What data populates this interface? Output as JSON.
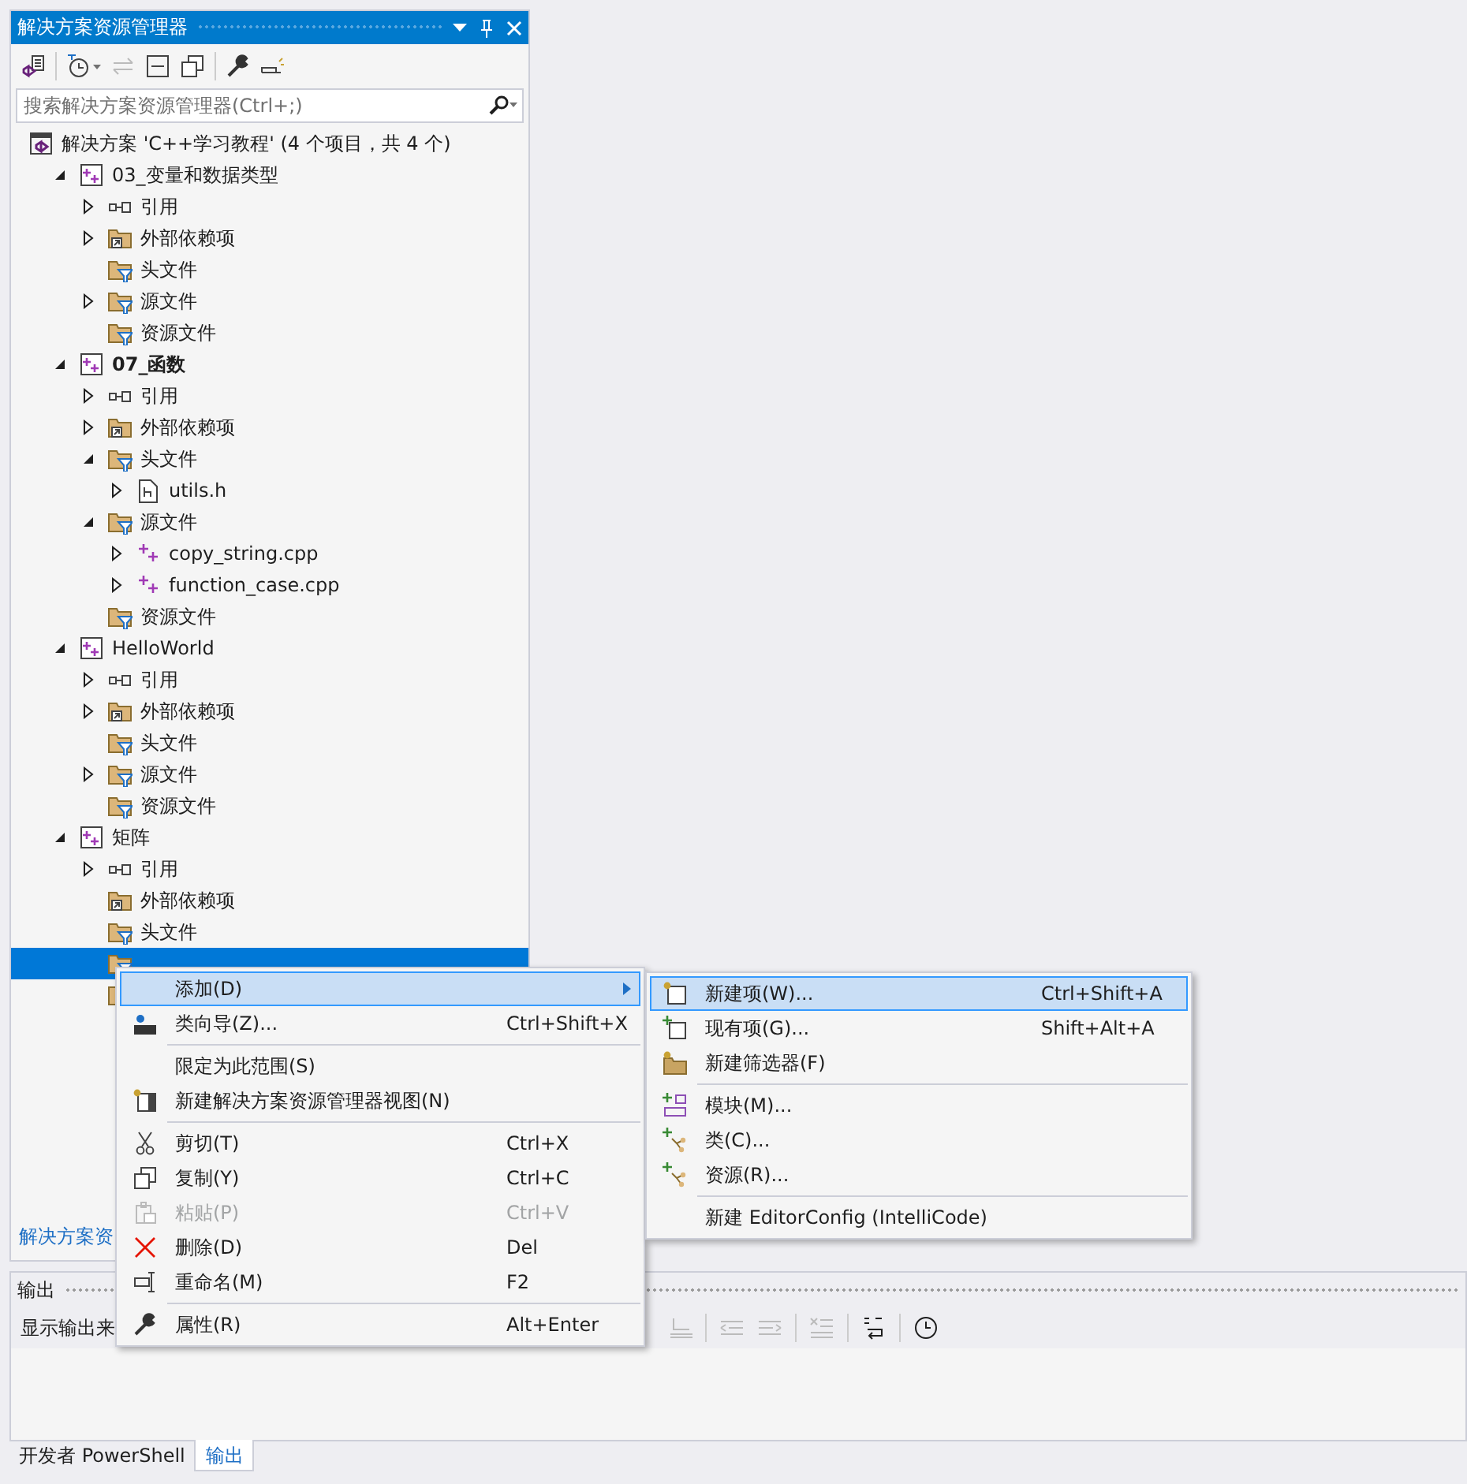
{
  "explorer": {
    "title": "解决方案资源管理器",
    "search": {
      "placeholder": "搜索解决方案资源管理器(Ctrl+;)"
    },
    "tree": [
      {
        "label": "解决方案 'C++学习教程' (4 个项目，共 4 个)",
        "kind": "solution",
        "selected": false,
        "children": [
          {
            "label": "03_变量和数据类型",
            "kind": "project",
            "expanded": true,
            "startup": false,
            "selected": false,
            "children": [
              {
                "label": "引用",
                "kind": "references",
                "expanded": false,
                "selected": false
              },
              {
                "label": "外部依赖项",
                "kind": "external",
                "expanded": false,
                "selected": false
              },
              {
                "label": "头文件",
                "kind": "filter",
                "selected": false
              },
              {
                "label": "源文件",
                "kind": "filter",
                "expanded": false,
                "selected": false
              },
              {
                "label": "资源文件",
                "kind": "filter",
                "selected": false
              }
            ]
          },
          {
            "label": "07_函数",
            "kind": "project",
            "expanded": true,
            "startup": true,
            "selected": false,
            "children": [
              {
                "label": "引用",
                "kind": "references",
                "expanded": false,
                "selected": false
              },
              {
                "label": "外部依赖项",
                "kind": "external",
                "expanded": false,
                "selected": false
              },
              {
                "label": "头文件",
                "kind": "filter",
                "expanded": true,
                "selected": false,
                "children": [
                  {
                    "label": "utils.h",
                    "kind": "header",
                    "expanded": false,
                    "selected": false
                  }
                ]
              },
              {
                "label": "源文件",
                "kind": "filter",
                "expanded": true,
                "selected": false,
                "children": [
                  {
                    "label": "copy_string.cpp",
                    "kind": "cpp",
                    "expanded": false,
                    "selected": false
                  },
                  {
                    "label": "function_case.cpp",
                    "kind": "cpp",
                    "expanded": false,
                    "selected": false
                  }
                ]
              },
              {
                "label": "资源文件",
                "kind": "filter",
                "selected": false
              }
            ]
          },
          {
            "label": "HelloWorld",
            "kind": "project",
            "expanded": true,
            "startup": false,
            "selected": false,
            "children": [
              {
                "label": "引用",
                "kind": "references",
                "expanded": false,
                "selected": false
              },
              {
                "label": "外部依赖项",
                "kind": "external",
                "expanded": false,
                "selected": false
              },
              {
                "label": "头文件",
                "kind": "filter",
                "selected": false
              },
              {
                "label": "源文件",
                "kind": "filter",
                "expanded": false,
                "selected": false
              },
              {
                "label": "资源文件",
                "kind": "filter",
                "selected": false
              }
            ]
          },
          {
            "label": "矩阵",
            "kind": "project",
            "expanded": true,
            "startup": false,
            "selected": false,
            "children": [
              {
                "label": "引用",
                "kind": "references",
                "expanded": false,
                "selected": false
              },
              {
                "label": "外部依赖项",
                "kind": "external",
                "selected": false
              },
              {
                "label": "头文件",
                "kind": "filter",
                "selected": false
              },
              {
                "kind": "filter",
                "selected": true
              },
              {
                "kind": "filter",
                "selected": false
              }
            ]
          }
        ]
      }
    ],
    "footer_link": "解决方案资"
  },
  "context_menu": {
    "groups": [
      [
        {
          "label": "添加(D)",
          "submenu": true,
          "selected": true,
          "disabled": false
        },
        {
          "label": "类向导(Z)...",
          "shortcut": "Ctrl+Shift+X",
          "submenu": false,
          "selected": false,
          "disabled": false
        }
      ],
      [
        {
          "label": "限定为此范围(S)",
          "submenu": false,
          "selected": false,
          "disabled": false
        },
        {
          "label": "新建解决方案资源管理器视图(N)",
          "submenu": false,
          "selected": false,
          "disabled": false
        }
      ],
      [
        {
          "label": "剪切(T)",
          "shortcut": "Ctrl+X",
          "submenu": false,
          "selected": false,
          "disabled": false
        },
        {
          "label": "复制(Y)",
          "shortcut": "Ctrl+C",
          "submenu": false,
          "selected": false,
          "disabled": false
        },
        {
          "label": "粘贴(P)",
          "shortcut": "Ctrl+V",
          "submenu": false,
          "selected": false,
          "disabled": true
        },
        {
          "label": "删除(D)",
          "shortcut": "Del",
          "submenu": false,
          "selected": false,
          "disabled": false
        },
        {
          "label": "重命名(M)",
          "shortcut": "F2",
          "submenu": false,
          "selected": false,
          "disabled": false
        }
      ],
      [
        {
          "label": "属性(R)",
          "shortcut": "Alt+Enter",
          "submenu": false,
          "selected": false,
          "disabled": false
        }
      ]
    ]
  },
  "submenu": {
    "groups": [
      [
        {
          "label": "新建项(W)...",
          "shortcut": "Ctrl+Shift+A",
          "submenu": false,
          "selected": true,
          "disabled": false
        },
        {
          "label": "现有项(G)...",
          "shortcut": "Shift+Alt+A",
          "submenu": false,
          "selected": false,
          "disabled": false
        },
        {
          "label": "新建筛选器(F)",
          "submenu": false,
          "selected": false,
          "disabled": false
        }
      ],
      [
        {
          "label": "模块(M)...",
          "submenu": false,
          "selected": false,
          "disabled": false
        },
        {
          "label": "类(C)...",
          "submenu": false,
          "selected": false,
          "disabled": false
        },
        {
          "label": "资源(R)...",
          "submenu": false,
          "selected": false,
          "disabled": false
        }
      ],
      [
        {
          "label": "新建 EditorConfig (IntelliCode)",
          "submenu": false,
          "selected": false,
          "disabled": false
        }
      ]
    ]
  },
  "output": {
    "title": "输出",
    "source_label": "显示输出来"
  },
  "bottom_tabs": [
    {
      "label": "开发者 PowerShell",
      "selected": false
    },
    {
      "label": "输出",
      "selected": true
    }
  ]
}
